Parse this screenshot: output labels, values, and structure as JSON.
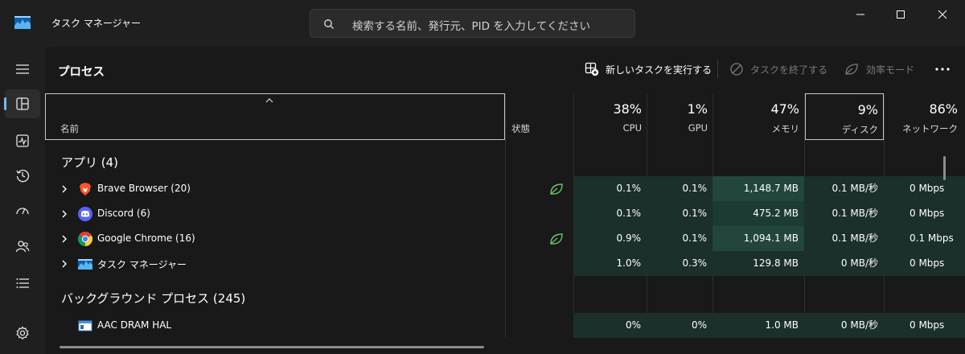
{
  "window": {
    "title": "タスク マネージャー",
    "search_placeholder": "検索する名前、発行元、PID を入力してください"
  },
  "nav": {
    "items": [
      "menu",
      "processes",
      "performance",
      "app-history",
      "startup",
      "users",
      "details",
      "settings"
    ],
    "active": "processes"
  },
  "page": {
    "title": "プロセス",
    "commands": {
      "new_task": "新しいタスクを実行する",
      "end_task": "タスクを終了する",
      "efficiency": "効率モード"
    }
  },
  "columns": {
    "name": "名前",
    "status": "状態",
    "cpu": {
      "label": "CPU",
      "pct": "38%"
    },
    "gpu": {
      "label": "GPU",
      "pct": "1%"
    },
    "memory": {
      "label": "メモリ",
      "pct": "47%"
    },
    "disk": {
      "label": "ディスク",
      "pct": "9%"
    },
    "network": {
      "label": "ネットワーク",
      "pct": "86%"
    }
  },
  "sections": {
    "apps": "アプリ (4)",
    "background": "バックグラウンド プロセス (245)"
  },
  "apps": [
    {
      "name": "Brave Browser (20)",
      "icon": "brave-icon",
      "eco": true,
      "cpu": "0.1%",
      "gpu": "0.1%",
      "memory": "1,148.7 MB",
      "disk": "0.1 MB/秒",
      "network": "0 Mbps"
    },
    {
      "name": "Discord (6)",
      "icon": "discord-icon",
      "eco": false,
      "cpu": "0.1%",
      "gpu": "0.1%",
      "memory": "475.2 MB",
      "disk": "0.1 MB/秒",
      "network": "0 Mbps"
    },
    {
      "name": "Google Chrome (16)",
      "icon": "chrome-icon",
      "eco": true,
      "cpu": "0.9%",
      "gpu": "0.1%",
      "memory": "1,094.1 MB",
      "disk": "0.1 MB/秒",
      "network": "0.1 Mbps"
    },
    {
      "name": "タスク マネージャー",
      "icon": "task-manager-icon",
      "eco": false,
      "cpu": "1.0%",
      "gpu": "0.3%",
      "memory": "129.8 MB",
      "disk": "0 MB/秒",
      "network": "0 Mbps"
    }
  ],
  "background": [
    {
      "name": "AAC DRAM HAL",
      "icon": "app-window-icon",
      "cpu": "0%",
      "gpu": "0%",
      "memory": "1.0 MB",
      "disk": "0 MB/秒",
      "network": "0 Mbps"
    }
  ],
  "colors": {
    "accent": "#76b9ed",
    "heat_low": "#1b2f2b",
    "heat_mid": "#1d3b35",
    "heat_high": "#22453c",
    "eco_green": "#6cc26c"
  }
}
